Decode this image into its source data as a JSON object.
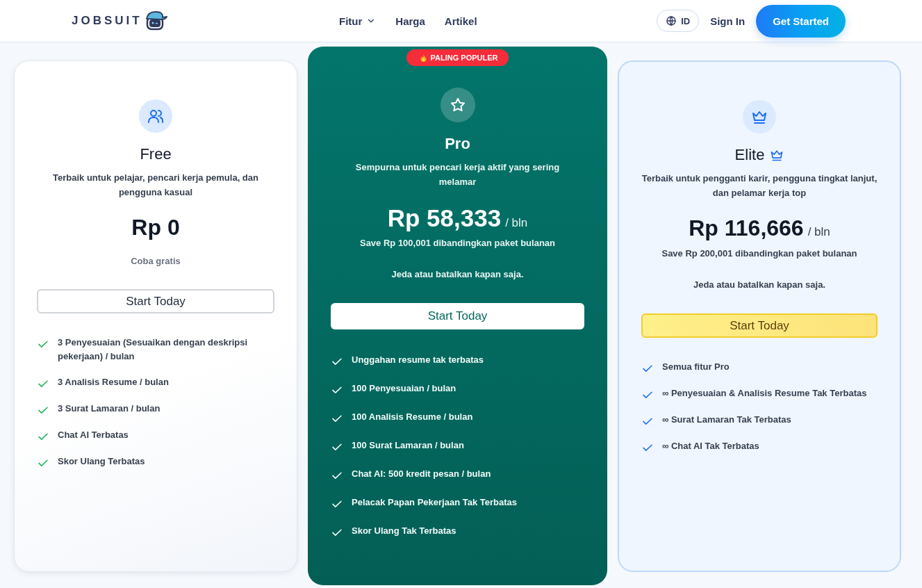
{
  "header": {
    "logo": "JOBSUIT",
    "nav": [
      {
        "label": "Fitur",
        "dropdown": true
      },
      {
        "label": "Harga",
        "dropdown": false
      },
      {
        "label": "Artikel",
        "dropdown": false
      }
    ],
    "language": "ID",
    "sign_in": "Sign In",
    "cta": "Get Started"
  },
  "plans": [
    {
      "kind": "free",
      "name": "Free",
      "description": "Terbaik untuk pelajar, pencari kerja pemula, dan pengguna kasual",
      "price": "Rp 0",
      "note": "Coba gratis",
      "button": "Start Today",
      "features": [
        "3 Penyesuaian (Sesuaikan dengan deskripsi pekerjaan) / bulan",
        "3 Analisis Resume / bulan",
        "3 Surat Lamaran / bulan",
        "Chat AI Terbatas",
        "Skor Ulang Terbatas"
      ]
    },
    {
      "kind": "pro",
      "badge": "PALING POPULER",
      "name": "Pro",
      "description": "Sempurna untuk pencari kerja aktif yang sering melamar",
      "price": "Rp 58,333",
      "period": "/ bln",
      "save": "Save Rp 100,001 dibandingkan paket bulanan",
      "note": "Jeda atau batalkan kapan saja.",
      "button": "Start Today",
      "features": [
        "Unggahan resume tak terbatas",
        "100 Penyesuaian / bulan",
        "100 Analisis Resume / bulan",
        "100 Surat Lamaran / bulan",
        "Chat AI: 500 kredit pesan / bulan",
        "Pelacak Papan Pekerjaan Tak Terbatas",
        "Skor Ulang Tak Terbatas"
      ]
    },
    {
      "kind": "elite",
      "name": "Elite",
      "description": "Terbaik untuk pengganti karir, pengguna tingkat lanjut, dan pelamar kerja top",
      "price": "Rp 116,666",
      "period": "/ bln",
      "save": "Save Rp 200,001 dibandingkan paket bulanan",
      "note": "Jeda atau batalkan kapan saja.",
      "button": "Start Today",
      "features": [
        "Semua fitur Pro",
        "∞ Penyesuaian & Analisis Resume Tak Terbatas",
        "∞ Surat Lamaran Tak Terbatas",
        "∞ Chat AI Tak Terbatas"
      ]
    }
  ]
}
